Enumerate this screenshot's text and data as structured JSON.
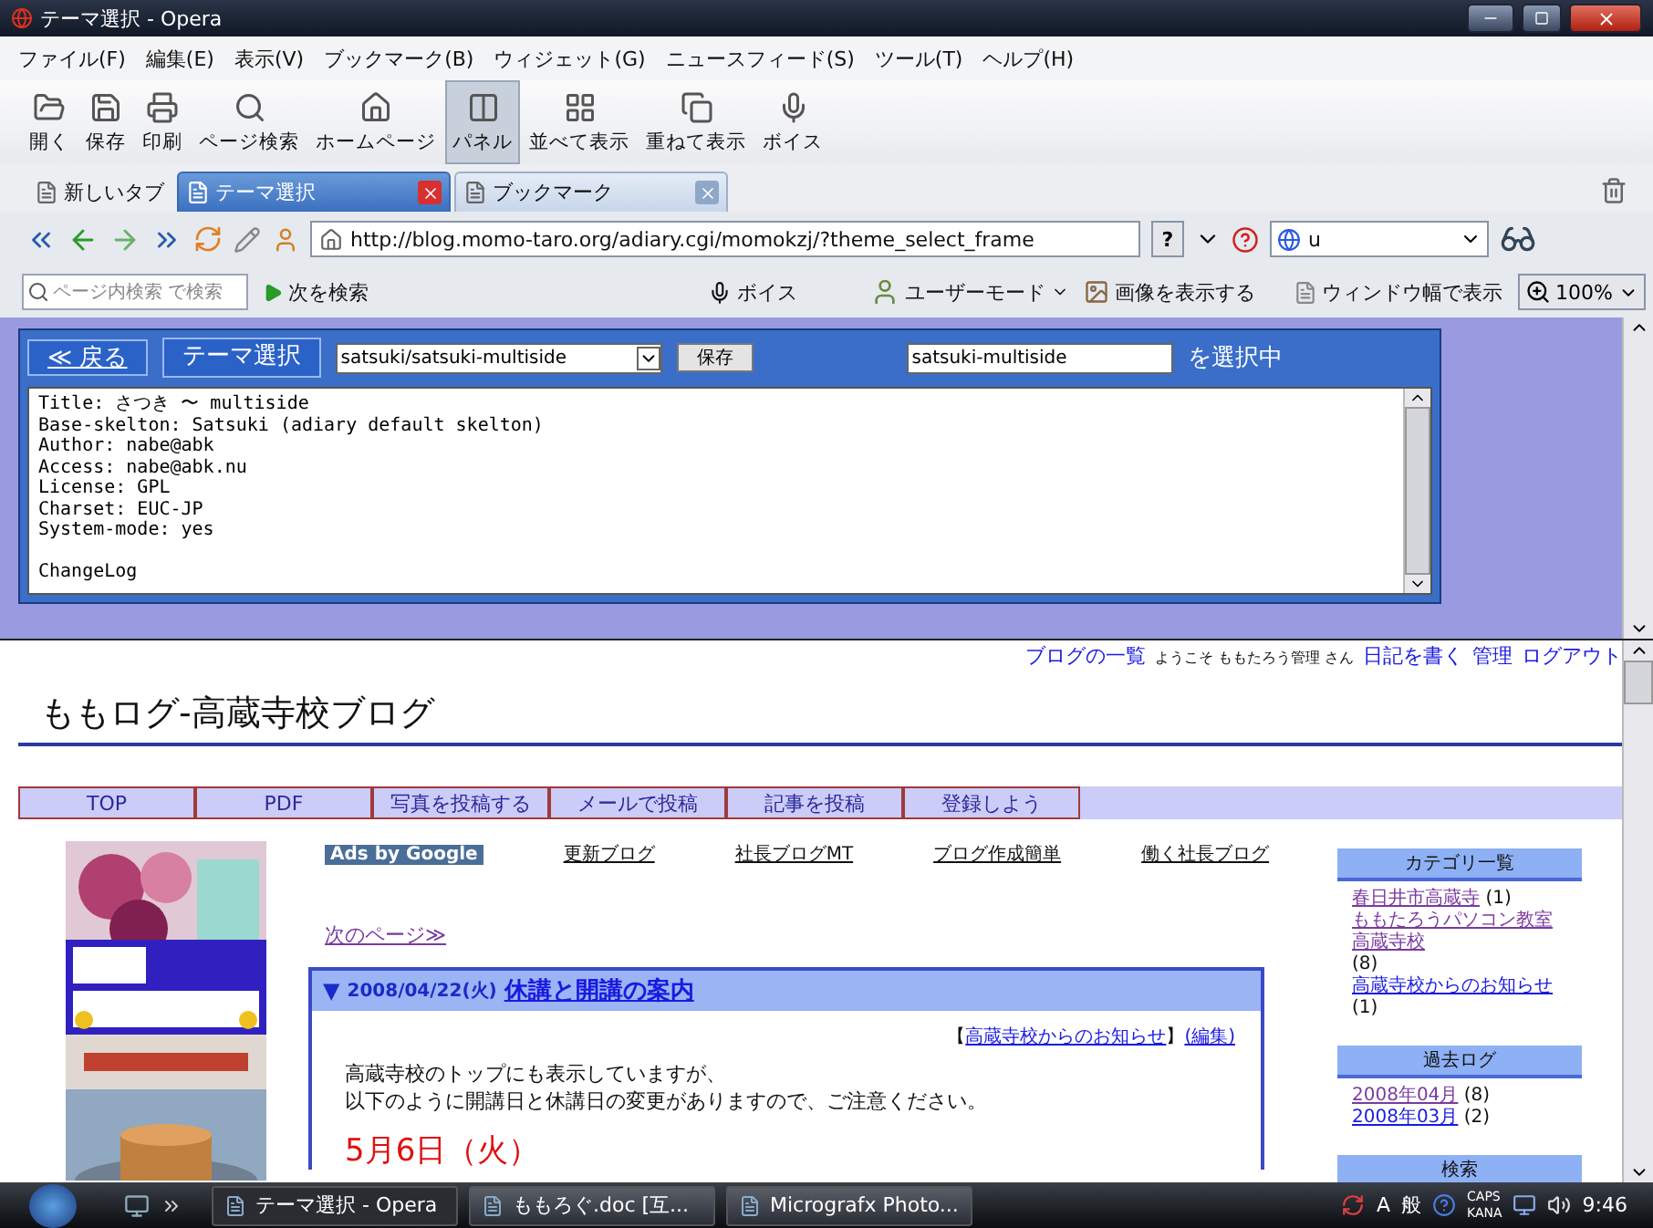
{
  "window": {
    "title": "テーマ選択 - Opera"
  },
  "menu": [
    "ファイル(F)",
    "編集(E)",
    "表示(V)",
    "ブックマーク(B)",
    "ウィジェット(G)",
    "ニュースフィード(S)",
    "ツール(T)",
    "ヘルプ(H)"
  ],
  "toolbar": [
    {
      "label": "開く",
      "selected": false
    },
    {
      "label": "保存",
      "selected": false
    },
    {
      "label": "印刷",
      "selected": false
    },
    {
      "label": "ページ検索",
      "selected": false
    },
    {
      "label": "ホームページ",
      "selected": false
    },
    {
      "label": "パネル",
      "selected": true
    },
    {
      "label": "並べて表示",
      "selected": false
    },
    {
      "label": "重ねて表示",
      "selected": false
    },
    {
      "label": "ボイス",
      "selected": false
    }
  ],
  "tabs": [
    {
      "label": "新しいタブ",
      "selected": false,
      "closable": false
    },
    {
      "label": "テーマ選択",
      "selected": true,
      "closable": true
    },
    {
      "label": "ブックマーク",
      "selected": false,
      "closable": true
    }
  ],
  "address_bar": {
    "url": "http://blog.momo-taro.org/adiary.cgi/momokzj/?theme_select_frame",
    "help": "?",
    "search_value": "u"
  },
  "find_bar": {
    "placeholder": "ページ内検索 で検索",
    "find_next": "次を検索",
    "voice": "ボイス",
    "user_mode": "ユーザーモード",
    "show_images": "画像を表示する",
    "fit_width": "ウィンドウ幅で表示",
    "zoom": "100%"
  },
  "theme_panel": {
    "back": "≪ 戻る",
    "title": "テーマ選択",
    "theme_select": "satsuki/satsuki-multiside",
    "save": "保存",
    "current_value": "satsuki-multiside",
    "current_suffix": "を選択中",
    "info_lines": [
      "Title: さつき 〜 multiside",
      "Base-skelton: Satsuki (adiary default skelton)",
      "Author: nabe@abk",
      "Access: nabe@abk.nu",
      "License: GPL",
      "Charset: EUC-JP",
      "System-mode: yes"
    ],
    "changelog": "ChangeLog"
  },
  "blog": {
    "user_nav": {
      "blog_list": "ブログの一覧",
      "welcome": "ようこそ ももたろう管理 さん",
      "write": "日記を書く",
      "admin": "管理",
      "logout": "ログアウト"
    },
    "title": "ももログ-高蔵寺校ブログ",
    "nav": [
      "TOP",
      "PDF",
      "写真を投稿する",
      "メールで投稿",
      "記事を投稿",
      "登録しよう"
    ],
    "ads_badge": "Ads by Google",
    "ad_links": [
      "更新ブログ",
      "社長ブログMT",
      "ブログ作成簡単",
      "働く社長ブログ"
    ],
    "next_page": "次のページ≫",
    "article": {
      "marker": "▼",
      "date": "2008/04/22(火)",
      "title": "休講と開講の案内",
      "category_open": "【",
      "category": "高蔵寺校からのお知らせ",
      "category_close": "】",
      "edit": "(編集)",
      "body": [
        "高蔵寺校のトップにも表示していますが、",
        "以下のように開講日と休講日の変更がありますので、ご注意ください。"
      ],
      "highlight": "5月6日（火）"
    },
    "sidebar": [
      {
        "heading": "カテゴリ一覧",
        "items": [
          {
            "label": "春日井市高蔵寺",
            "count": "(1)",
            "visited": true
          },
          {
            "label": "ももたろうパソコン教室高蔵寺校",
            "count": "(8)",
            "visited": true
          },
          {
            "label": "高蔵寺校からのお知らせ",
            "count": "(1)",
            "visited": false
          }
        ]
      },
      {
        "heading": "過去ログ",
        "items": [
          {
            "label": "2008年04月",
            "count": "(8)",
            "visited": true
          },
          {
            "label": "2008年03月",
            "count": "(2)",
            "visited": false
          }
        ]
      },
      {
        "heading": "検索"
      }
    ]
  },
  "taskbar": {
    "items": [
      {
        "label": "テーマ選択 - Opera",
        "selected": true
      },
      {
        "label": "ももろぐ.doc [互...",
        "selected": false
      },
      {
        "label": "Micrografx Photo...",
        "selected": false
      }
    ],
    "tray": {
      "ime_a": "A",
      "ime_mode": "般",
      "caps": "CAPS",
      "kana": "KANA",
      "clock": "9:46"
    }
  }
}
